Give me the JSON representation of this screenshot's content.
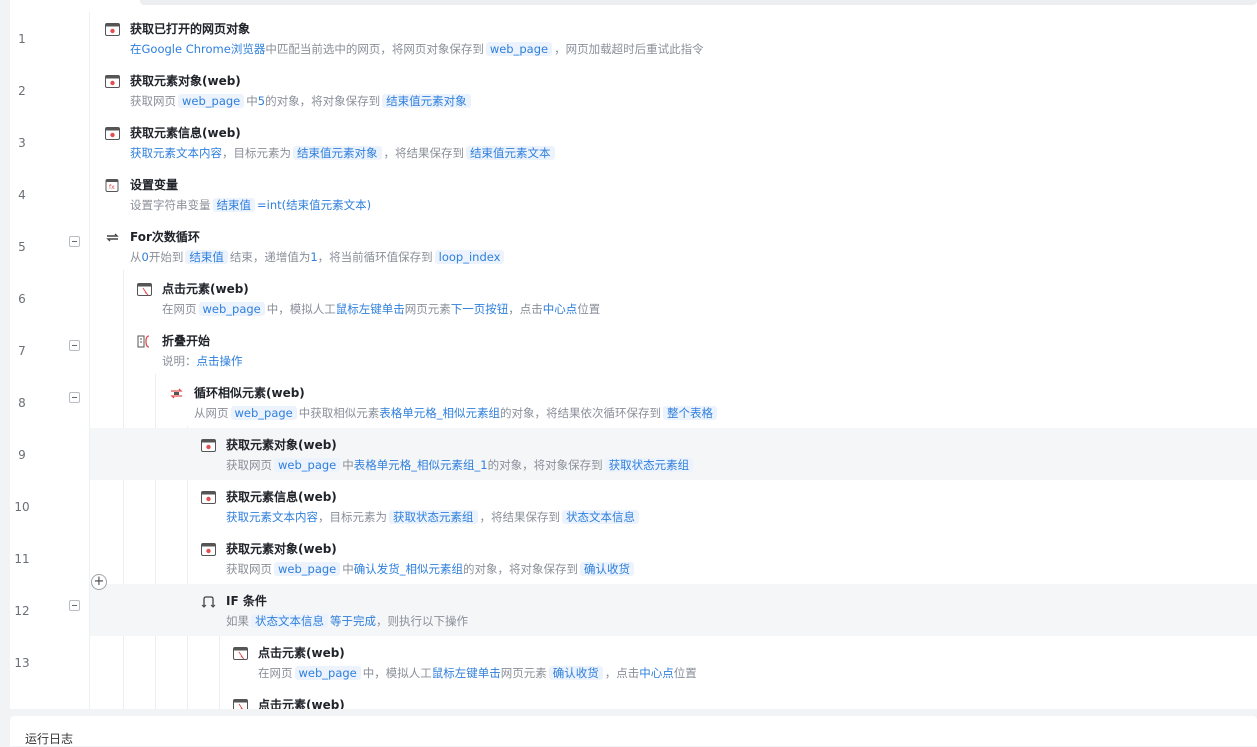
{
  "colors": {
    "accent": "#2e7fdc",
    "tag_bg": "#edf3fc",
    "icon_red": "#e05050"
  },
  "rows": [
    {
      "num": "1",
      "icon": "browser-icon",
      "title": "获取已打开的网页对象",
      "desc": [
        {
          "t": "在Google Chrome浏览器",
          "k": "b"
        },
        {
          "t": "中匹配当前选中的网页，将网页对象保存到"
        },
        {
          "t": "web_page",
          "k": "tag"
        },
        {
          "t": "，网页加载超时后重试此指令"
        }
      ]
    },
    {
      "num": "2",
      "icon": "browser-icon",
      "title": "获取元素对象(web)",
      "desc": [
        {
          "t": "获取网页"
        },
        {
          "t": "web_page",
          "k": "tag"
        },
        {
          "t": "中"
        },
        {
          "t": "5",
          "k": "b"
        },
        {
          "t": "的对象，将对象保存到"
        },
        {
          "t": "结束值元素对象",
          "k": "tag"
        }
      ]
    },
    {
      "num": "3",
      "icon": "browser-icon",
      "title": "获取元素信息(web)",
      "desc": [
        {
          "t": "获取元素文本内容",
          "k": "b"
        },
        {
          "t": "，目标元素为"
        },
        {
          "t": "结束值元素对象",
          "k": "tag"
        },
        {
          "t": "，将结果保存到"
        },
        {
          "t": "结束值元素文本",
          "k": "tag"
        }
      ]
    },
    {
      "num": "4",
      "icon": "variable-icon",
      "title": "设置变量",
      "desc": [
        {
          "t": "设置字符串变量"
        },
        {
          "t": "结束值",
          "k": "tag"
        },
        {
          "t": "=int(结束值元素文本)",
          "k": "b"
        }
      ]
    },
    {
      "num": "5",
      "icon": "loop-icon",
      "title": "For次数循环",
      "fold": true,
      "desc": [
        {
          "t": "从"
        },
        {
          "t": "0",
          "k": "b"
        },
        {
          "t": "开始到"
        },
        {
          "t": "结束值",
          "k": "tag"
        },
        {
          "t": "结束，递增值为"
        },
        {
          "t": "1",
          "k": "b"
        },
        {
          "t": "，将当前循环值保存到"
        },
        {
          "t": "loop_index",
          "k": "tag"
        }
      ]
    },
    {
      "num": "6",
      "icon": "click-icon",
      "title": "点击元素(web)",
      "desc": [
        {
          "t": "在网页"
        },
        {
          "t": "web_page",
          "k": "tag"
        },
        {
          "t": "中，模拟人工"
        },
        {
          "t": "鼠标左键单击",
          "k": "b"
        },
        {
          "t": "网页元素"
        },
        {
          "t": "下一页按钮",
          "k": "b"
        },
        {
          "t": "，点击"
        },
        {
          "t": "中心点",
          "k": "b"
        },
        {
          "t": "位置"
        }
      ]
    },
    {
      "num": "7",
      "icon": "fold-start-icon",
      "title": "折叠开始",
      "fold": true,
      "desc": [
        {
          "t": "说明："
        },
        {
          "t": "点击操作",
          "k": "b"
        }
      ]
    },
    {
      "num": "8",
      "icon": "loop-similar-icon",
      "title": "循环相似元素(web)",
      "fold": true,
      "desc": [
        {
          "t": "从网页"
        },
        {
          "t": "web_page",
          "k": "tag"
        },
        {
          "t": "中获取相似元素"
        },
        {
          "t": "表格单元格_相似元素组",
          "k": "b"
        },
        {
          "t": "的对象，将结果依次循环保存到"
        },
        {
          "t": "整个表格",
          "k": "tag"
        }
      ]
    },
    {
      "num": "9",
      "icon": "browser-icon",
      "title": "获取元素对象(web)",
      "hl": true,
      "desc": [
        {
          "t": "获取网页"
        },
        {
          "t": "web_page",
          "k": "tag"
        },
        {
          "t": "中"
        },
        {
          "t": "表格单元格_相似元素组_1",
          "k": "b"
        },
        {
          "t": "的对象，将对象保存到"
        },
        {
          "t": "获取状态元素组",
          "k": "tag"
        }
      ]
    },
    {
      "num": "10",
      "icon": "browser-icon",
      "title": "获取元素信息(web)",
      "desc": [
        {
          "t": "获取元素文本内容",
          "k": "b"
        },
        {
          "t": "，目标元素为"
        },
        {
          "t": "获取状态元素组",
          "k": "tag"
        },
        {
          "t": "，将结果保存到"
        },
        {
          "t": "状态文本信息",
          "k": "tag"
        }
      ]
    },
    {
      "num": "11",
      "icon": "browser-icon",
      "title": "获取元素对象(web)",
      "desc": [
        {
          "t": "获取网页"
        },
        {
          "t": "web_page",
          "k": "tag"
        },
        {
          "t": "中"
        },
        {
          "t": "确认发货_相似元素组",
          "k": "b"
        },
        {
          "t": "的对象，将对象保存到"
        },
        {
          "t": "确认收货",
          "k": "tag"
        }
      ]
    },
    {
      "num": "12",
      "icon": "if-icon",
      "title": "IF 条件",
      "fold": true,
      "hl": true,
      "desc": [
        {
          "t": "如果"
        },
        {
          "t": "状态文本信息",
          "k": "tag"
        },
        {
          "t": "等于完成",
          "k": "b"
        },
        {
          "t": "，则执行以下操作"
        }
      ]
    },
    {
      "num": "13",
      "icon": "click-icon",
      "title": "点击元素(web)",
      "desc": [
        {
          "t": "在网页"
        },
        {
          "t": "web_page",
          "k": "tag"
        },
        {
          "t": "中，模拟人工"
        },
        {
          "t": "鼠标左键单击",
          "k": "b"
        },
        {
          "t": "网页元素"
        },
        {
          "t": "确认收货",
          "k": "tag"
        },
        {
          "t": "，点击"
        },
        {
          "t": "中心点",
          "k": "b"
        },
        {
          "t": "位置"
        }
      ]
    },
    {
      "num": "",
      "icon": "click-icon",
      "title": "点击元素(web)",
      "desc": []
    }
  ],
  "add_step_symbol": "+",
  "log_panel": {
    "title": "运行日志"
  }
}
